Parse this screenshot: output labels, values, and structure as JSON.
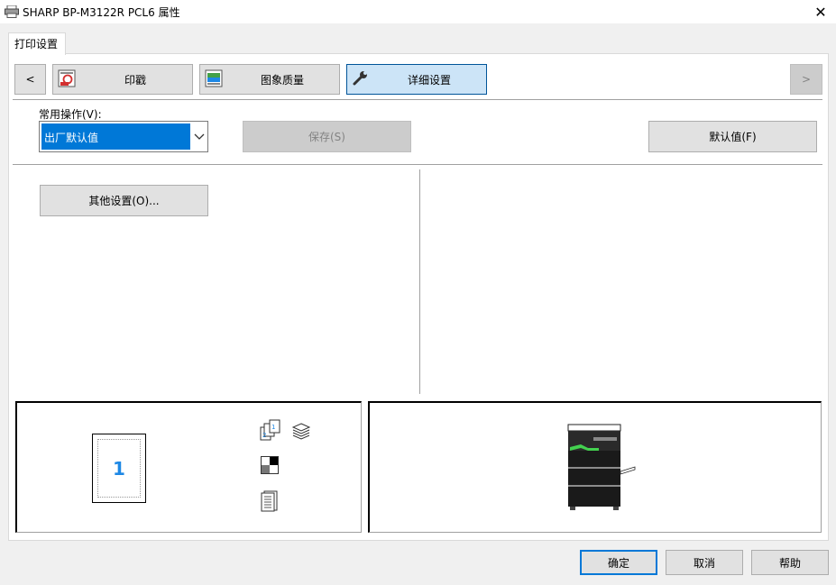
{
  "window": {
    "title": "SHARP BP-M3122R PCL6 属性",
    "icon": "printer-icon",
    "close_glyph": "✕"
  },
  "tabs": [
    {
      "label": "打印设置",
      "active": true
    }
  ],
  "toolbar": {
    "prev_glyph": "<",
    "next_glyph": ">",
    "items": [
      {
        "label": "印戳",
        "icon": "stamp-icon",
        "selected": false
      },
      {
        "label": "图象质量",
        "icon": "image-quality-icon",
        "selected": false
      },
      {
        "label": "详细设置",
        "icon": "wrench-icon",
        "selected": true
      }
    ]
  },
  "common_ops": {
    "label": "常用操作(V):",
    "selected_value": "出厂默认值",
    "save_label": "保存(S)",
    "default_label": "默认值(F)"
  },
  "other_settings_label": "其他设置(O)...",
  "preview": {
    "page_number": "1",
    "status_icons": [
      "collate-icon",
      "stack-icon",
      "color-mode-icon",
      "binding-icon"
    ],
    "printer_icon": "printer-machine-icon"
  },
  "footer": {
    "ok_label": "确定",
    "cancel_label": "取消",
    "help_label": "帮助"
  },
  "colors": {
    "selection": "#0078d7",
    "selected_button": "#cce4f7",
    "selected_border": "#005499",
    "page_number": "#1e88e5"
  }
}
